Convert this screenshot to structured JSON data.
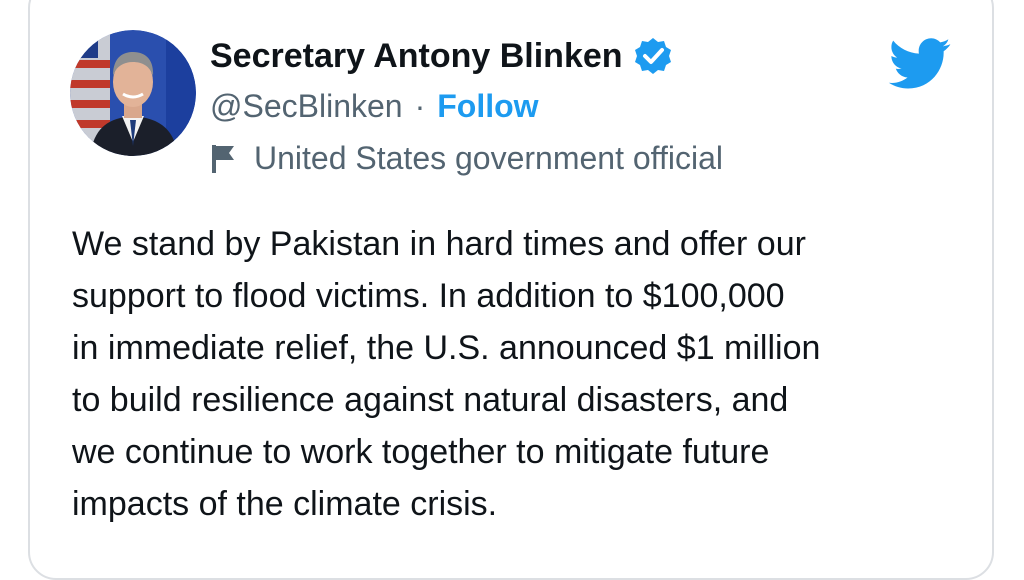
{
  "author": {
    "display_name": "Secretary Antony Blinken",
    "handle": "@SecBlinken",
    "separator": "·",
    "follow_label": "Follow",
    "account_label": "United States government official",
    "verified_icon": "verified-badge-icon",
    "label_icon": "flag-icon"
  },
  "platform_icon": "twitter-bird-icon",
  "tweet": {
    "lines": [
      "We stand by Pakistan in hard times and offer our",
      "support to flood victims. In addition to $100,000",
      "in immediate relief, the U.S. announced $1 million",
      "to build resilience against natural disasters, and",
      "we continue to work together to mitigate future",
      "impacts of the climate crisis."
    ]
  },
  "colors": {
    "accent": "#1d9bf0",
    "text": "#0f1419",
    "secondary": "#536471",
    "border": "#dcdfe3"
  }
}
